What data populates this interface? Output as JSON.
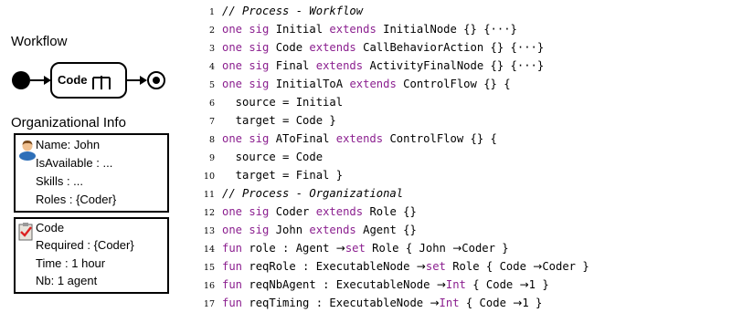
{
  "workflow": {
    "title": "Workflow",
    "node_label": "Code"
  },
  "org_info": {
    "title": "Organizational Info",
    "agent": {
      "name": "Name: John",
      "available": "IsAvailable : ...",
      "skills": "Skills : ...",
      "roles": "Roles : {Coder}"
    },
    "task": {
      "name": "Code",
      "required": "Required : {Coder}",
      "time": "Time : 1 hour",
      "nb": "Nb: 1 agent"
    }
  },
  "code": {
    "keyword_color": "#8b1f8f",
    "lines": [
      {
        "n": "1",
        "parts": [
          {
            "t": "// Process - Workflow",
            "c": "cm"
          }
        ]
      },
      {
        "n": "2",
        "parts": [
          {
            "t": "one sig",
            "c": "kw"
          },
          {
            "t": " Initial "
          },
          {
            "t": "extends",
            "c": "kw"
          },
          {
            "t": " InitialNode {} {···}"
          }
        ]
      },
      {
        "n": "3",
        "parts": [
          {
            "t": "one sig",
            "c": "kw"
          },
          {
            "t": " Code "
          },
          {
            "t": "extends",
            "c": "kw"
          },
          {
            "t": " CallBehaviorAction {} {···}"
          }
        ]
      },
      {
        "n": "4",
        "parts": [
          {
            "t": "one sig",
            "c": "kw"
          },
          {
            "t": " Final "
          },
          {
            "t": "extends",
            "c": "kw"
          },
          {
            "t": " ActivityFinalNode {} {···}"
          }
        ]
      },
      {
        "n": "5",
        "parts": [
          {
            "t": "one sig",
            "c": "kw"
          },
          {
            "t": " InitialToA "
          },
          {
            "t": "extends",
            "c": "kw"
          },
          {
            "t": " ControlFlow {} {"
          }
        ]
      },
      {
        "n": "6",
        "parts": [
          {
            "t": "  source = Initial"
          }
        ]
      },
      {
        "n": "7",
        "parts": [
          {
            "t": "  target = Code }"
          }
        ]
      },
      {
        "n": "8",
        "parts": [
          {
            "t": "one sig",
            "c": "kw"
          },
          {
            "t": " AToFinal "
          },
          {
            "t": "extends",
            "c": "kw"
          },
          {
            "t": " ControlFlow {} {"
          }
        ]
      },
      {
        "n": "9",
        "parts": [
          {
            "t": "  source = Code"
          }
        ]
      },
      {
        "n": "10",
        "parts": [
          {
            "t": "  target = Final }"
          }
        ]
      },
      {
        "n": "11",
        "parts": [
          {
            "t": "// Process - Organizational",
            "c": "cm"
          }
        ]
      },
      {
        "n": "12",
        "parts": [
          {
            "t": "one sig",
            "c": "kw"
          },
          {
            "t": " Coder "
          },
          {
            "t": "extends",
            "c": "kw"
          },
          {
            "t": " Role {}"
          }
        ]
      },
      {
        "n": "13",
        "parts": [
          {
            "t": "one sig",
            "c": "kw"
          },
          {
            "t": " John "
          },
          {
            "t": "extends",
            "c": "kw"
          },
          {
            "t": " Agent {}"
          }
        ]
      },
      {
        "n": "14",
        "parts": [
          {
            "t": "fun",
            "c": "kw"
          },
          {
            "t": " role : Agent "
          },
          {
            "t": "→",
            "c": "sym"
          },
          {
            "t": "set",
            "c": "kw"
          },
          {
            "t": " Role { John "
          },
          {
            "t": "→",
            "c": "sym"
          },
          {
            "t": "Coder }"
          }
        ]
      },
      {
        "n": "15",
        "parts": [
          {
            "t": "fun",
            "c": "kw"
          },
          {
            "t": " reqRole : ExecutableNode "
          },
          {
            "t": "→",
            "c": "sym"
          },
          {
            "t": "set",
            "c": "kw"
          },
          {
            "t": " Role { Code "
          },
          {
            "t": "→",
            "c": "sym"
          },
          {
            "t": "Coder }"
          }
        ]
      },
      {
        "n": "16",
        "parts": [
          {
            "t": "fun",
            "c": "kw"
          },
          {
            "t": " reqNbAgent : ExecutableNode "
          },
          {
            "t": "→",
            "c": "sym"
          },
          {
            "t": "Int",
            "c": "kw"
          },
          {
            "t": " { Code "
          },
          {
            "t": "→",
            "c": "sym"
          },
          {
            "t": "1 }"
          }
        ]
      },
      {
        "n": "17",
        "parts": [
          {
            "t": "fun",
            "c": "kw"
          },
          {
            "t": " reqTiming : ExecutableNode "
          },
          {
            "t": "→",
            "c": "sym"
          },
          {
            "t": "Int",
            "c": "kw"
          },
          {
            "t": " { Code "
          },
          {
            "t": "→",
            "c": "sym"
          },
          {
            "t": "1 }"
          }
        ]
      }
    ]
  }
}
